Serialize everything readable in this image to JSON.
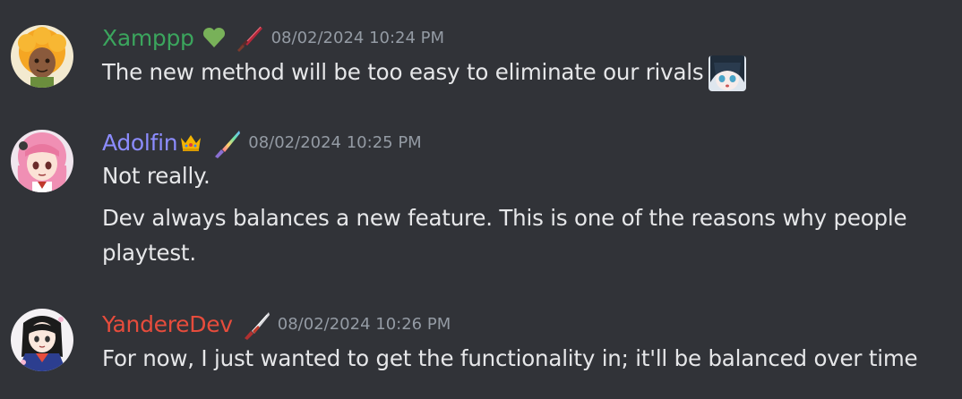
{
  "colors": {
    "background": "#313338",
    "timestamp": "#949ba4",
    "text": "#e6e7e9"
  },
  "messages": [
    {
      "username": "Xamppp",
      "username_color": "#3ba55d",
      "badges": [
        "green-heart-icon",
        "red-dagger-icon"
      ],
      "timestamp": "08/02/2024 10:24 PM",
      "lines": [
        "The new method will be too easy to eliminate our rivals"
      ],
      "emote": "anime-girl-emote"
    },
    {
      "username": "Adolfin",
      "username_color": "#8c8cff",
      "badges": [
        "crown-icon",
        "rainbow-knife-icon"
      ],
      "timestamp": "08/02/2024 10:25 PM",
      "lines": [
        "Not really.",
        "Dev always balances a new feature. This is one of the reasons why people",
        "playtest."
      ]
    },
    {
      "username": "YandereDev",
      "username_color": "#e74c3c",
      "badges": [
        "bloody-knife-icon"
      ],
      "timestamp": "08/02/2024 10:26 PM",
      "lines": [
        "For now, I just wanted to get the functionality in; it'll be balanced over time"
      ]
    }
  ]
}
